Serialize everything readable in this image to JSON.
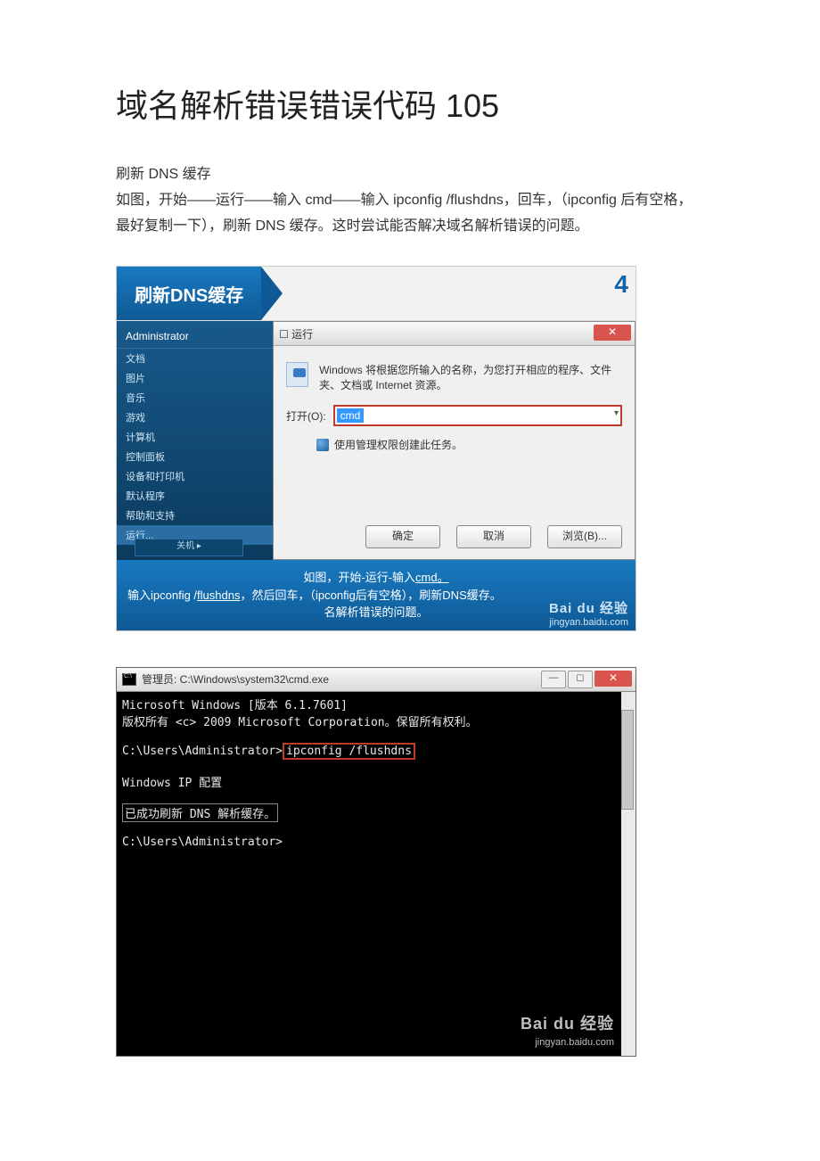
{
  "title": "域名解析错误错误代码 105",
  "section_heading": "刷新 DNS 缓存",
  "body_text": "如图，开始——运行——输入 cmd——输入 ipconfig  /flushdns，回车，（ipconfig 后有空格，最好复制一下），刷新 DNS 缓存。这时尝试能否解决域名解析错误的问题。",
  "shot1": {
    "step_label": "刷新DNS缓存",
    "step_number": "4",
    "startmenu": {
      "admin": "Administrator",
      "items": [
        "文档",
        "图片",
        "音乐",
        "游戏",
        "计算机",
        "控制面板",
        "设备和打印机",
        "默认程序",
        "帮助和支持"
      ],
      "selected": "运行...",
      "power": "关机  ▸"
    },
    "run": {
      "title": "运行",
      "desc": "Windows 将根据您所输入的名称，为您打开相应的程序、文件夹、文档或 Internet 资源。",
      "open_label": "打开(O):",
      "input_value": "cmd",
      "admin_note": "使用管理权限创建此任务。",
      "ok": "确定",
      "cancel": "取消",
      "browse": "浏览(B)..."
    },
    "caption_prefix": "输入ipconfig /",
    "caption_underlined": "flushdns",
    "caption_mid1": "，然后回车，",
    "caption_top": "如图，开始-运行-输入",
    "caption_top_under": "cmd。",
    "caption_mid2": "（ipconfig后有空格），刷新DNS缓存。",
    "caption_tail": "名解析错误的问题。",
    "watermark_brand": "Bai du 经验",
    "watermark_url": "jingyan.baidu.com"
  },
  "shot2": {
    "title": "管理员: C:\\Windows\\system32\\cmd.exe",
    "line1": "Microsoft Windows [版本 6.1.7601]",
    "line2": "版权所有 <c> 2009 Microsoft Corporation。保留所有权利。",
    "prompt1": "C:\\Users\\Administrator>",
    "command": "ipconfig /flushdns",
    "line_cfg": "Windows IP 配置",
    "line_ok": "已成功刷新 DNS 解析缓存。",
    "prompt2": "C:\\Users\\Administrator>",
    "watermark_brand": "Bai du 经验",
    "watermark_url": "jingyan.baidu.com"
  }
}
